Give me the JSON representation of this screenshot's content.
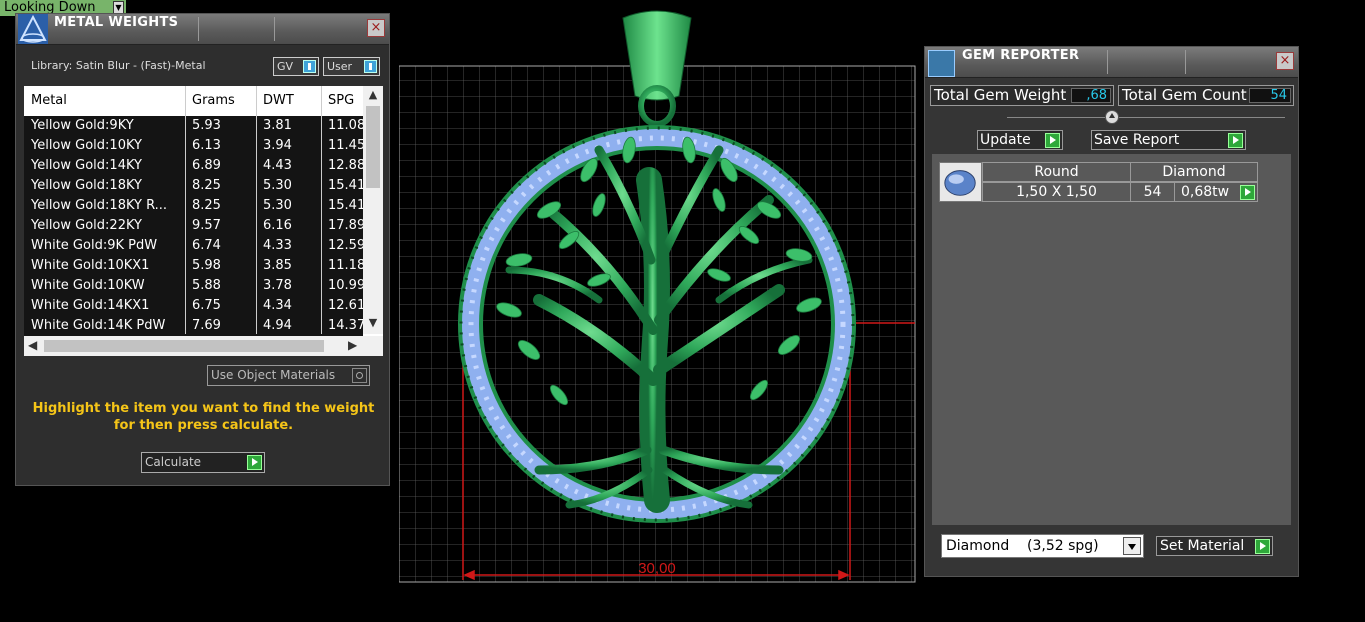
{
  "viewport": {
    "label": "Looking Down",
    "dimension": "30,00"
  },
  "metal_panel": {
    "title": "METAL WEIGHTS",
    "close": "×",
    "library": "Library: Satin Blur - (Fast)-Metal",
    "toggle_gv": "GV",
    "toggle_user": "User",
    "columns": [
      "Metal",
      "Grams",
      "DWT",
      "SPG"
    ],
    "rows": [
      [
        "Yellow Gold:9KY",
        "5.93",
        "3.81",
        "11.08"
      ],
      [
        "Yellow Gold:10KY",
        "6.13",
        "3.94",
        "11.45"
      ],
      [
        "Yellow Gold:14KY",
        "6.89",
        "4.43",
        "12.88"
      ],
      [
        "Yellow Gold:18KY",
        "8.25",
        "5.30",
        "15.41"
      ],
      [
        "Yellow Gold:18KY R...",
        "8.25",
        "5.30",
        "15.41"
      ],
      [
        "Yellow Gold:22KY",
        "9.57",
        "6.16",
        "17.89"
      ],
      [
        "White Gold:9K PdW",
        "6.74",
        "4.33",
        "12.59"
      ],
      [
        "White Gold:10KX1",
        "5.98",
        "3.85",
        "11.18"
      ],
      [
        "White Gold:10KW",
        "5.88",
        "3.78",
        "10.99"
      ],
      [
        "White Gold:14KX1",
        "6.75",
        "4.34",
        "12.61"
      ],
      [
        "White Gold:14K PdW",
        "7.69",
        "4.94",
        "14.37"
      ]
    ],
    "use_object_materials": "Use Object Materials",
    "hint": "Highlight the item you want to find the weight for then press calculate.",
    "calculate": "Calculate"
  },
  "gem_panel": {
    "title": "GEM REPORTER",
    "close": "×",
    "total_weight_label": "Total Gem Weight",
    "total_weight_value": ",68",
    "total_count_label": "Total Gem Count",
    "total_count_value": "54",
    "update": "Update",
    "save_report": "Save Report",
    "gem_header": [
      "Round",
      "Diamond"
    ],
    "gem_row": {
      "size": "1,50 X 1,50",
      "count": "54",
      "weight": "0,68tw"
    },
    "material_select": "Diamond    (3,52 spg)",
    "set_material": "Set Material"
  }
}
